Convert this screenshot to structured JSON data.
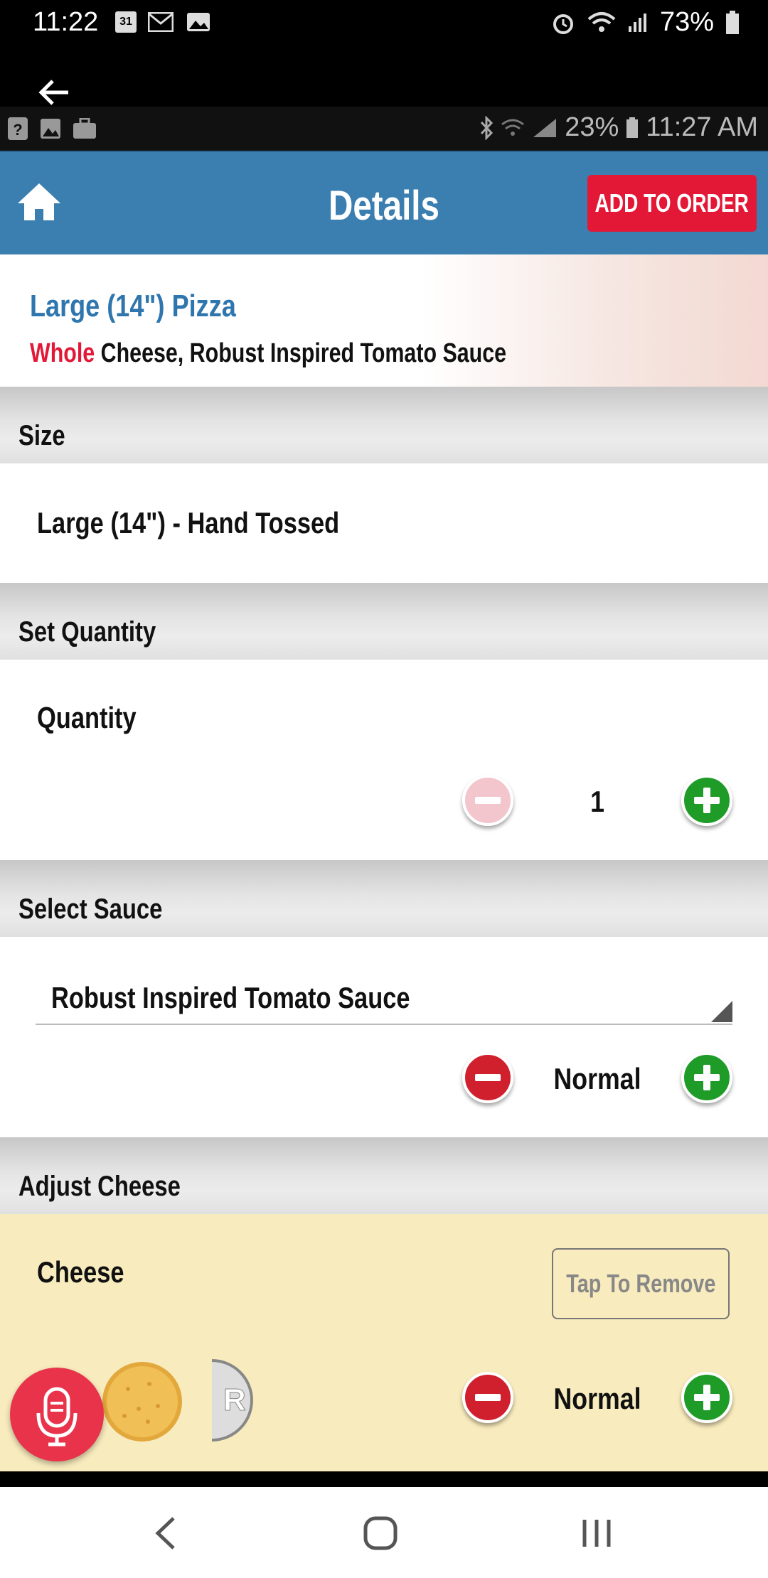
{
  "system_bar": {
    "time": "11:22",
    "calendar_day": "31",
    "battery": "73%"
  },
  "inner_status": {
    "battery": "23%",
    "time": "11:27 AM"
  },
  "app_bar": {
    "title": "Details",
    "add_to_order": "ADD TO ORDER"
  },
  "product": {
    "title": "Large (14\") Pizza",
    "portion": "Whole",
    "description": "Cheese, Robust Inspired Tomato Sauce"
  },
  "size": {
    "header": "Size",
    "value": "Large (14\") - Hand Tossed"
  },
  "quantity": {
    "header": "Set Quantity",
    "label": "Quantity",
    "value": "1"
  },
  "sauce": {
    "header": "Select Sauce",
    "selected": "Robust Inspired Tomato Sauce",
    "amount": "Normal"
  },
  "cheese": {
    "header": "Adjust Cheese",
    "label": "Cheese",
    "tap_to_remove": "Tap To Remove",
    "amount": "Normal",
    "badge_letter": "R"
  },
  "colors": {
    "app_bar": "#3a7fb0",
    "accent_red": "#e31837",
    "plus_green": "#1f9b28",
    "cheese_bg": "#f8ebbd"
  }
}
